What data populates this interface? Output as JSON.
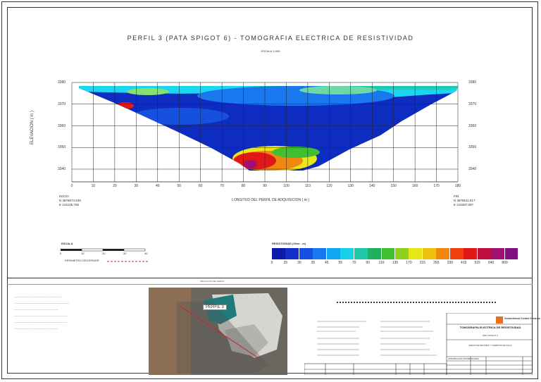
{
  "header": {
    "title": "PERFIL 3  (PATA SPIGOT 6) - TOMOGRAFIA ELECTRICA DE RESISTIVIDAD",
    "scale": "ESCALA 1:500"
  },
  "profile": {
    "y_axis_label": "ELEVACION ( m )",
    "x_axis_label": "LONGITUD DEL PERFIL DE ADQUISICION ( m )",
    "y_ticks": [
      "3380",
      "3370",
      "3360",
      "3350",
      "3340"
    ],
    "y_ticks_right": [
      "3380",
      "3370",
      "3360",
      "3350",
      "3340"
    ],
    "x_ticks": [
      "0",
      "10",
      "20",
      "30",
      "40",
      "50",
      "60",
      "70",
      "80",
      "90",
      "100",
      "110",
      "120",
      "130",
      "140",
      "150",
      "160",
      "170",
      "180"
    ],
    "start": {
      "label": "INICIO",
      "n": "N  3878674.939",
      "e": "E   216145.758"
    },
    "end": {
      "label": "FIN",
      "n": "N  3878511.917",
      "e": "E   216287.097"
    }
  },
  "scale_bar": {
    "title": "ESCALA",
    "ticks": [
      "0",
      "10",
      "20",
      "30",
      "40"
    ],
    "legend_text": "PERIMETRO GEOSPIDER",
    "legend_color": "#d42020"
  },
  "colorbar": {
    "title": "RESISTIVIDAD (Ohm - m)",
    "labels": [
      "0",
      "25",
      "30",
      "35",
      "45",
      "55",
      "70",
      "90",
      "110",
      "135",
      "170",
      "215",
      "265",
      "330",
      "415",
      "515",
      "640",
      "800"
    ],
    "colors": [
      "#0b1aa8",
      "#1230c8",
      "#1650e0",
      "#1a78ee",
      "#10a8f0",
      "#18d0e8",
      "#20c8a8",
      "#20b060",
      "#40c030",
      "#90d020",
      "#e8e818",
      "#f0c010",
      "#f08810",
      "#f04010",
      "#e01818",
      "#c01040",
      "#a01070",
      "#801080"
    ]
  },
  "photo": {
    "title": "UBICACION DEL PERFIL",
    "label": "PERFIL 3"
  },
  "title_block": {
    "company": "Geotechnical Control Systems",
    "title": "TOMOGRAFIA ELECTRICA DE RESISTIVIDAD",
    "subtitle": "PATA SPIGOT 6",
    "area": "AREAS DE RECREO Y CUERPOS DE AGUA",
    "approval_label": "APROBACION APROBADORES"
  }
}
